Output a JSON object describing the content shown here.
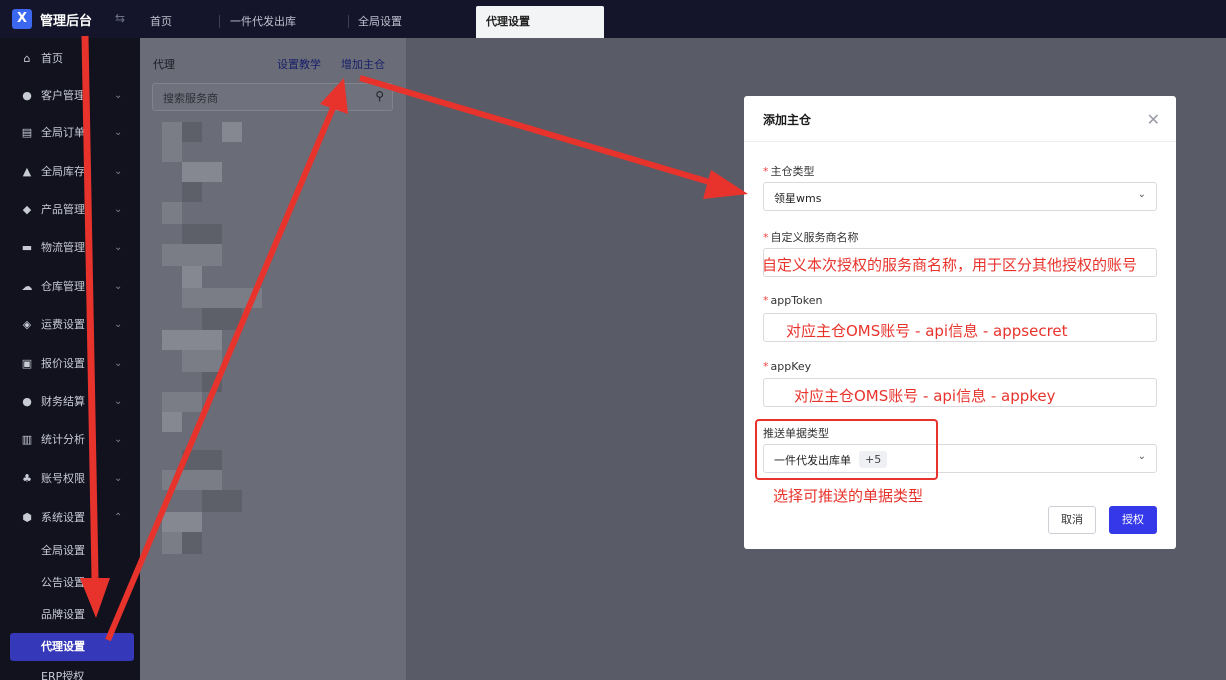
{
  "app": {
    "title": "管理后台",
    "logo_glyph": "X"
  },
  "tabs": [
    {
      "label": "首页"
    },
    {
      "label": "一件代发出库"
    },
    {
      "label": "全局设置"
    },
    {
      "label": "代理设置"
    }
  ],
  "sidebar": {
    "items": [
      {
        "label": "首页",
        "icon": "home-icon"
      },
      {
        "label": "客户管理",
        "icon": "users-icon"
      },
      {
        "label": "全局订单",
        "icon": "order-icon"
      },
      {
        "label": "全局库存",
        "icon": "warehouse-icon"
      },
      {
        "label": "产品管理",
        "icon": "product-icon"
      },
      {
        "label": "物流管理",
        "icon": "truck-icon"
      },
      {
        "label": "仓库管理",
        "icon": "storage-icon"
      },
      {
        "label": "运费设置",
        "icon": "freight-icon"
      },
      {
        "label": "报价设置",
        "icon": "quote-icon"
      },
      {
        "label": "财务结算",
        "icon": "finance-icon"
      },
      {
        "label": "统计分析",
        "icon": "stats-icon"
      },
      {
        "label": "账号权限",
        "icon": "account-icon"
      },
      {
        "label": "系统设置",
        "icon": "settings-icon"
      }
    ],
    "sub_items": [
      {
        "label": "全局设置"
      },
      {
        "label": "公告设置"
      },
      {
        "label": "品牌设置"
      },
      {
        "label": "代理设置"
      },
      {
        "label": "ERP授权"
      }
    ]
  },
  "agent_panel": {
    "title": "代理",
    "tutorial_link": "设置教学",
    "add_link": "增加主仓",
    "search_placeholder": "搜索服务商"
  },
  "modal": {
    "title": "添加主仓",
    "warehouse_type_label": "主仓类型",
    "warehouse_type_value": "领星wms",
    "provider_name_label": "自定义服务商名称",
    "provider_name_hint": "自定义本次授权的服务商名称，用于区分其他授权的账号",
    "app_token_label": "appToken",
    "app_token_hint": "对应主仓OMS账号 - api信息 - appsecret",
    "app_key_label": "appKey",
    "app_key_hint": "对应主仓OMS账号 - api信息 - appkey",
    "push_type_label": "推送单据类型",
    "push_type_value": "一件代发出库单",
    "push_type_more": "+5",
    "push_type_hint": "选择可推送的单据类型",
    "cancel_label": "取消",
    "ok_label": "授权"
  },
  "colors": {
    "accent": "#3538e8",
    "annotation": "#e8332c",
    "sidebar_bg": "#11121e"
  }
}
